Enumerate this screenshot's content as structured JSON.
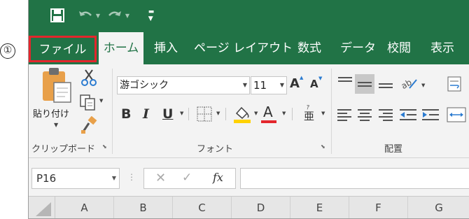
{
  "annotation": {
    "step_number": "①"
  },
  "quick_access": {
    "save_icon": "save-icon",
    "undo_icon": "undo-icon",
    "redo_icon": "redo-icon"
  },
  "tabs": {
    "file": "ファイル",
    "home": "ホーム",
    "insert": "挿入",
    "page_layout": "ページ レイアウト",
    "formulas": "数式",
    "data": "データ",
    "review": "校閲",
    "view": "表示"
  },
  "ribbon": {
    "clipboard": {
      "paste_label": "貼り付け",
      "group_label": "クリップボード"
    },
    "font": {
      "font_name": "游ゴシック",
      "font_size": "11",
      "group_label": "フォント",
      "phonetic_glyph": "亜"
    },
    "alignment": {
      "group_label": "配置"
    }
  },
  "formula_bar": {
    "name_box": "P16",
    "fx_label": "fx"
  },
  "columns": [
    "A",
    "B",
    "C",
    "D",
    "E",
    "F",
    "G"
  ],
  "colors": {
    "excel_green": "#217346",
    "highlight_red": "#e3262c",
    "fill_yellow": "#ffd200",
    "font_red": "#e3262c"
  }
}
